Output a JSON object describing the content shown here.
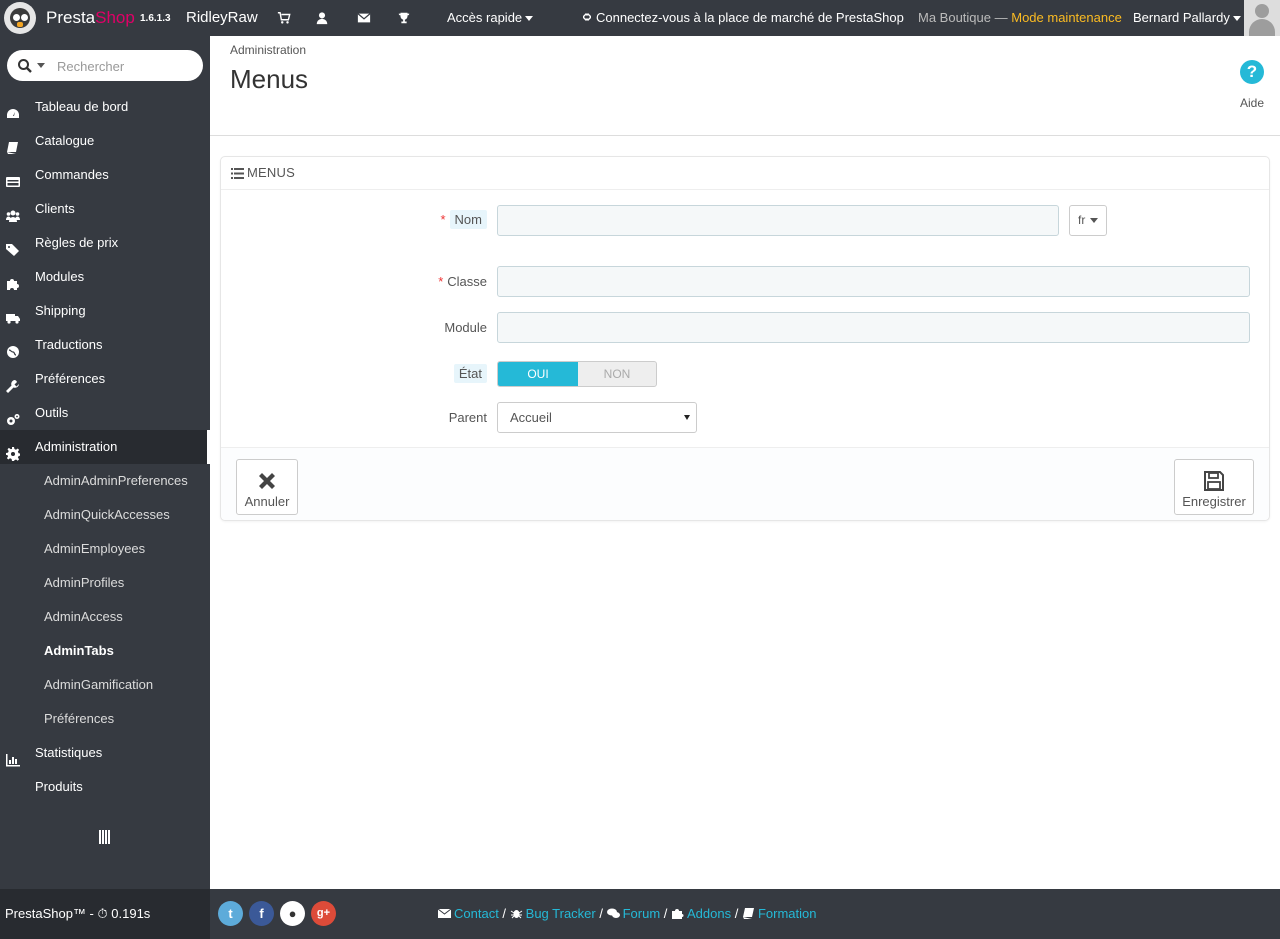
{
  "header": {
    "brand_presta": "Presta",
    "brand_shop": "Shop",
    "version": "1.6.1.3",
    "shop_name": "RidleyRaw",
    "quick_access": "Accès rapide",
    "marketplace": "Connectez-vous à la place de marché de PrestaShop",
    "boutique": "Ma Boutique",
    "separator": " — ",
    "maintenance": "Mode maintenance",
    "user": "Bernard Pallardy"
  },
  "search": {
    "placeholder": "Rechercher"
  },
  "sidebar": {
    "items": [
      {
        "label": "Tableau de bord",
        "icon": "dashboard-icon"
      },
      {
        "label": "Catalogue",
        "icon": "book-icon"
      },
      {
        "label": "Commandes",
        "icon": "credit-card-icon"
      },
      {
        "label": "Clients",
        "icon": "users-icon"
      },
      {
        "label": "Règles de prix",
        "icon": "tags-icon"
      },
      {
        "label": "Modules",
        "icon": "puzzle-icon"
      },
      {
        "label": "Shipping",
        "icon": "truck-icon"
      },
      {
        "label": "Traductions",
        "icon": "globe-icon"
      },
      {
        "label": "Préférences",
        "icon": "wrench-icon"
      },
      {
        "label": "Outils",
        "icon": "cogs-icon"
      },
      {
        "label": "Administration",
        "icon": "cog-icon"
      }
    ],
    "subitems": [
      "AdminAdminPreferences",
      "AdminQuickAccesses",
      "AdminEmployees",
      "AdminProfiles",
      "AdminAccess",
      "AdminTabs",
      "AdminGamification",
      "Préférences"
    ],
    "bottom_items": [
      {
        "label": "Statistiques",
        "icon": "bar-chart-icon"
      },
      {
        "label": "Produits",
        "icon": ""
      }
    ]
  },
  "toolbar": {
    "breadcrumb": "Administration",
    "title": "Menus",
    "help": "Aide"
  },
  "panel": {
    "heading": "Menus",
    "fields": {
      "nom_label": "Nom",
      "nom_value": "",
      "lang": "fr",
      "classe_label": "Classe",
      "classe_value": "",
      "module_label": "Module",
      "module_value": "",
      "etat_label": "État",
      "etat_on": "OUI",
      "etat_off": "NON",
      "etat_value": "OUI",
      "parent_label": "Parent",
      "parent_value": "Accueil"
    },
    "cancel": "Annuler",
    "save": "Enregistrer"
  },
  "footer": {
    "brand": "PrestaShop™",
    "time_sep": " - ",
    "time": "0.191s",
    "links": [
      "Contact",
      "Bug Tracker",
      "Forum",
      "Addons",
      "Formation"
    ],
    "link_sep": " / "
  },
  "colors": {
    "accent": "#25b9d7",
    "brand_pink": "#df0067",
    "maintenance": "#fbbb22",
    "dark": "#363a41",
    "twitter": "#5dabda",
    "facebook": "#3b5998",
    "github": "#ffffff",
    "google": "#dd4b39"
  }
}
